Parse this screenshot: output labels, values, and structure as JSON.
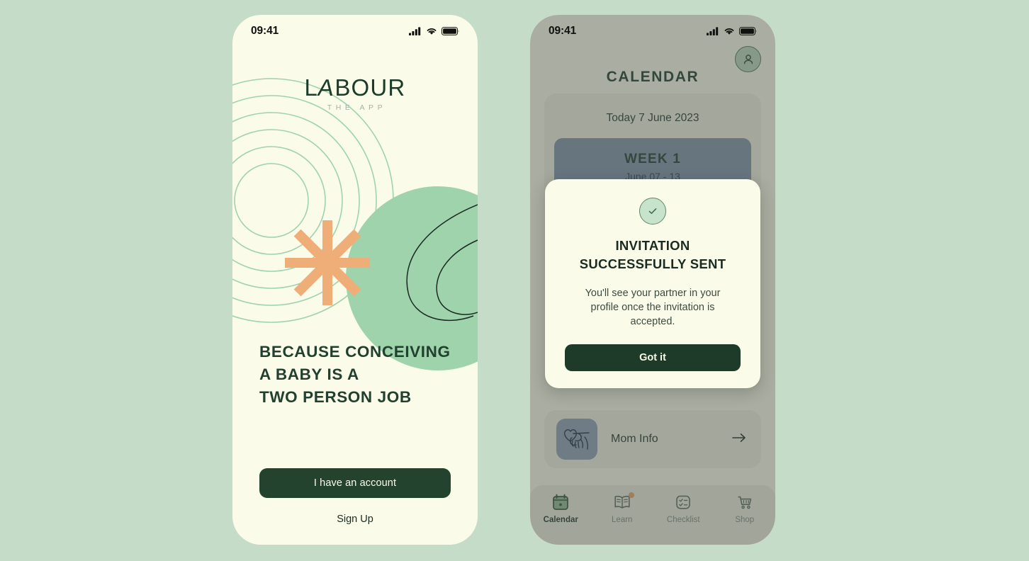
{
  "theme": {
    "page_bg": "#C4DCC8",
    "screen_bg": "#FBFBE9",
    "dark_green": "#1E3B2A",
    "accent_orange": "#EFAE78",
    "mint_green": "#9ED3AC",
    "blue_gray": "#7E91A8",
    "card_bg": "#F0F0DD"
  },
  "left_screen": {
    "status": {
      "time": "09:41",
      "cellular_icon": "signal-bars-icon",
      "wifi_icon": "wifi-icon",
      "battery_icon": "battery-full-icon"
    },
    "logo": {
      "main": "LABOUR",
      "main_a": "A",
      "main_before": "L",
      "main_after": "BOUR",
      "sub": "THE APP"
    },
    "decor": {
      "rings_icon": "concentric-rings-graphic",
      "asterisk_icon": "eight-point-star-graphic",
      "blob_icon": "green-circle-graphic",
      "curves_icon": "nested-curve-lines-graphic"
    },
    "headline_lines": [
      "BECAUSE CONCEIVING",
      "A BABY IS A",
      "TWO PERSON JOB"
    ],
    "primary_button": "I have an account",
    "secondary_link": "Sign Up"
  },
  "right_screen": {
    "status": {
      "time": "09:41",
      "cellular_icon": "signal-bars-icon",
      "wifi_icon": "wifi-icon",
      "battery_icon": "battery-full-icon"
    },
    "header": {
      "title": "CALENDAR",
      "avatar_icon": "user-profile-icon"
    },
    "calendar_card": {
      "today_label": "Today 7 June 2023",
      "week_title": "WEEK 1",
      "week_range": "June 07 - 13"
    },
    "info_card": {
      "label": "Mom Info",
      "thumb_icon": "baby-hand-holding-finger-icon",
      "arrow_icon": "arrow-right-icon"
    },
    "tabbar": [
      {
        "label": "Calendar",
        "icon": "calendar-icon",
        "active": true,
        "badge": false
      },
      {
        "label": "Learn",
        "icon": "open-book-icon",
        "active": false,
        "badge": true
      },
      {
        "label": "Checklist",
        "icon": "checklist-icon",
        "active": false,
        "badge": false
      },
      {
        "label": "Shop",
        "icon": "shopping-cart-icon",
        "active": false,
        "badge": false
      }
    ],
    "modal": {
      "check_icon": "checkmark-circle-icon",
      "title": "INVITATION SUCCESSFULLY SENT",
      "body": "You'll see your partner in your profile once the invitation is accepted.",
      "button": "Got it"
    }
  }
}
